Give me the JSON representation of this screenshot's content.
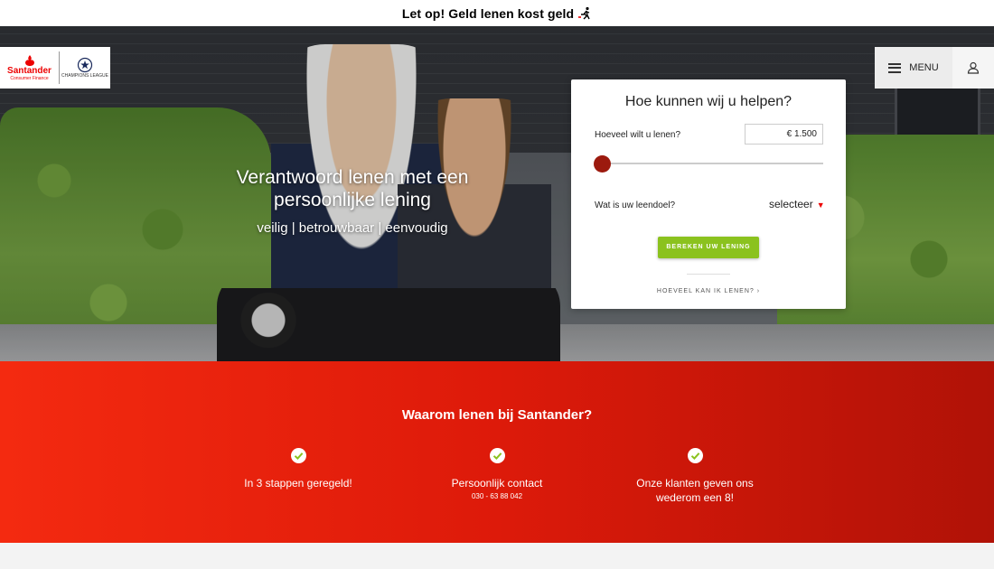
{
  "topbar": {
    "text": "Let op! Geld lenen kost geld"
  },
  "logo": {
    "brand": "Santander",
    "sub": "Consumer Finance",
    "partner": "CHAMPIONS LEAGUE"
  },
  "header": {
    "menu_label": "MENU"
  },
  "hero": {
    "title": "Verantwoord lenen met een persoonlijke lening",
    "subtitle": "veilig | betrouwbaar | eenvoudig"
  },
  "calculator": {
    "title": "Hoe kunnen wij u helpen?",
    "amount_label": "Hoeveel wilt u lenen?",
    "amount_value": "€ 1.500",
    "slider_level": 0,
    "purpose_label": "Wat is uw leendoel?",
    "purpose_value": "selecteer",
    "button_label": "BEREKEN UW LENING",
    "link_label": "HOEVEEL KAN IK LENEN? ›"
  },
  "why": {
    "title": "Waarom lenen bij Santander?",
    "items": [
      {
        "label": "In 3 stappen geregeld!"
      },
      {
        "label": "Persoonlijk contact",
        "phone": "030 - 63 88 042"
      },
      {
        "label": "Onze klanten geven ons wederom een 8!"
      }
    ]
  },
  "colors": {
    "brand_red": "#ec0000",
    "button_green": "#8bc21e",
    "slider_red": "#9c1a0e"
  }
}
